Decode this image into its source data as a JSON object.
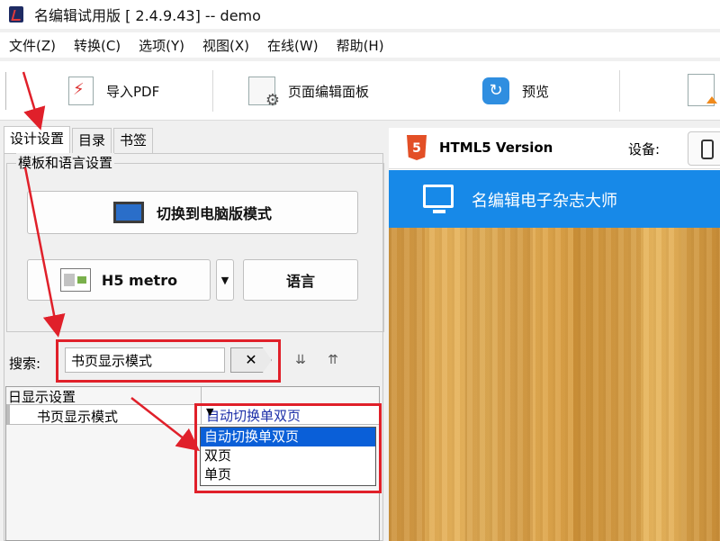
{
  "window": {
    "title": "名编辑试用版 [ 2.4.9.43] -- demo"
  },
  "menu": [
    "文件(Z)",
    "转换(C)",
    "选项(Y)",
    "视图(X)",
    "在线(W)",
    "帮助(H)"
  ],
  "toolbar": {
    "import_pdf": "导入PDF",
    "page_editor": "页面编辑面板",
    "preview": "预览"
  },
  "tabs": [
    "设计设置",
    "目录",
    "书签"
  ],
  "design": {
    "group_label": "模板和语言设置",
    "switch_mode_label": "切换到电脑版模式",
    "template_label": "H5 metro",
    "language_label": "语言"
  },
  "search": {
    "label": "搜索:",
    "value": "书页显示模式",
    "clear": "✕"
  },
  "grid": {
    "category": "日显示设置",
    "property_name": "书页显示模式",
    "property_value": "自动切换单双页",
    "options": [
      "自动切换单双页",
      "双页",
      "单页"
    ]
  },
  "preview_pane": {
    "version_badge": "5",
    "version_title": "HTML5 Version",
    "device_label": "设备:",
    "banner_text": "名编辑电子杂志大师"
  },
  "colors": {
    "annotation_red": "#e0202a",
    "banner_blue": "#1789e8",
    "selected_blue": "#0a5fd8"
  }
}
